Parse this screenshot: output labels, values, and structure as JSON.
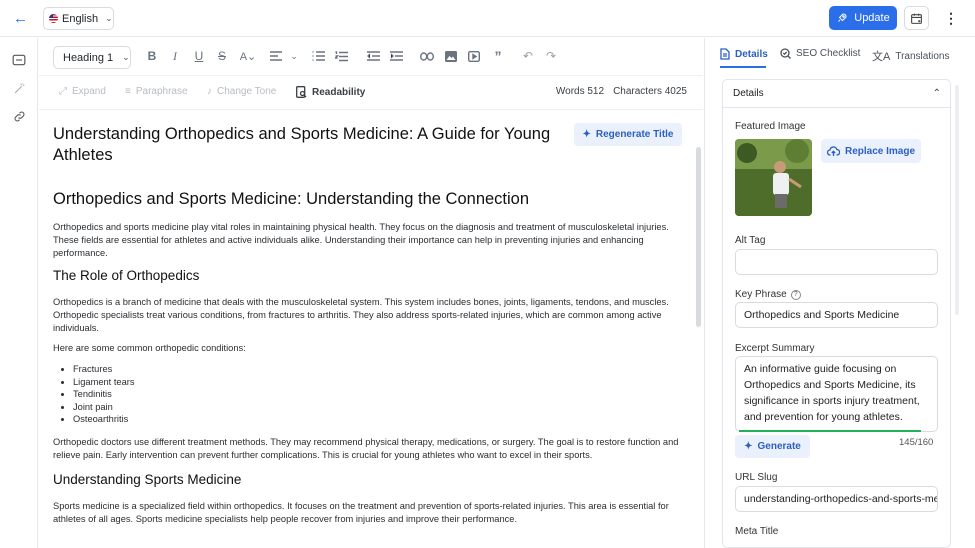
{
  "topbar": {
    "language": "English",
    "update_label": "Update"
  },
  "toolbar": {
    "block_type": "Heading 1"
  },
  "subbar": {
    "expand": "Expand",
    "paraphrase": "Paraphrase",
    "change_tone": "Change Tone",
    "readability": "Readability",
    "words": "Words 512",
    "characters": "Characters 4025"
  },
  "doc": {
    "title": "Understanding Orthopedics and Sports Medicine: A Guide for Young Athletes",
    "regenerate_label": "Regenerate Title",
    "h2": "Orthopedics and Sports Medicine: Understanding the Connection",
    "p1": "Orthopedics and sports medicine play vital roles in maintaining physical health. They focus on the diagnosis and treatment of musculoskeletal injuries. These fields are essential for athletes and active individuals alike. Understanding their importance can help in preventing injuries and enhancing performance.",
    "h3a": "The Role of Orthopedics",
    "p2": "Orthopedics is a branch of medicine that deals with the musculoskeletal system. This system includes bones, joints, ligaments, tendons, and muscles. Orthopedic specialists treat various conditions, from fractures to arthritis. They also address sports-related injuries, which are common among active individuals.",
    "p3": "Here are some common orthopedic conditions:",
    "list": [
      "Fractures",
      "Ligament tears",
      "Tendinitis",
      "Joint pain",
      "Osteoarthritis"
    ],
    "p4": "Orthopedic doctors use different treatment methods. They may recommend physical therapy, medications, or surgery. The goal is to restore function and relieve pain. Early intervention can prevent further complications. This is crucial for young athletes who want to excel in their sports.",
    "h3b": "Understanding Sports Medicine",
    "p5": "Sports medicine is a specialized field within orthopedics. It focuses on the treatment and prevention of sports-related injuries. This area is essential for athletes of all ages. Sports medicine specialists help people recover from injuries and improve their performance."
  },
  "right": {
    "tabs": [
      "Details",
      "SEO Checklist",
      "Translations"
    ],
    "section_title": "Details",
    "featured_image_label": "Featured Image",
    "replace_image_label": "Replace Image",
    "alt_tag_label": "Alt Tag",
    "alt_tag_value": "",
    "key_phrase_label": "Key Phrase",
    "key_phrase_value": "Orthopedics and Sports Medicine",
    "excerpt_label": "Excerpt Summary",
    "excerpt_value": "An informative guide focusing on Orthopedics and Sports Medicine, its significance in sports injury treatment, and prevention for young athletes.",
    "excerpt_progress": 0.906,
    "generate_label": "Generate",
    "excerpt_count": "145/160",
    "url_slug_label": "URL Slug",
    "url_slug_value": "understanding-orthopedics-and-sports-medicine",
    "meta_title_label": "Meta Title"
  },
  "colors": {
    "accent": "#2b6ee9",
    "progress": "#22b05a"
  }
}
